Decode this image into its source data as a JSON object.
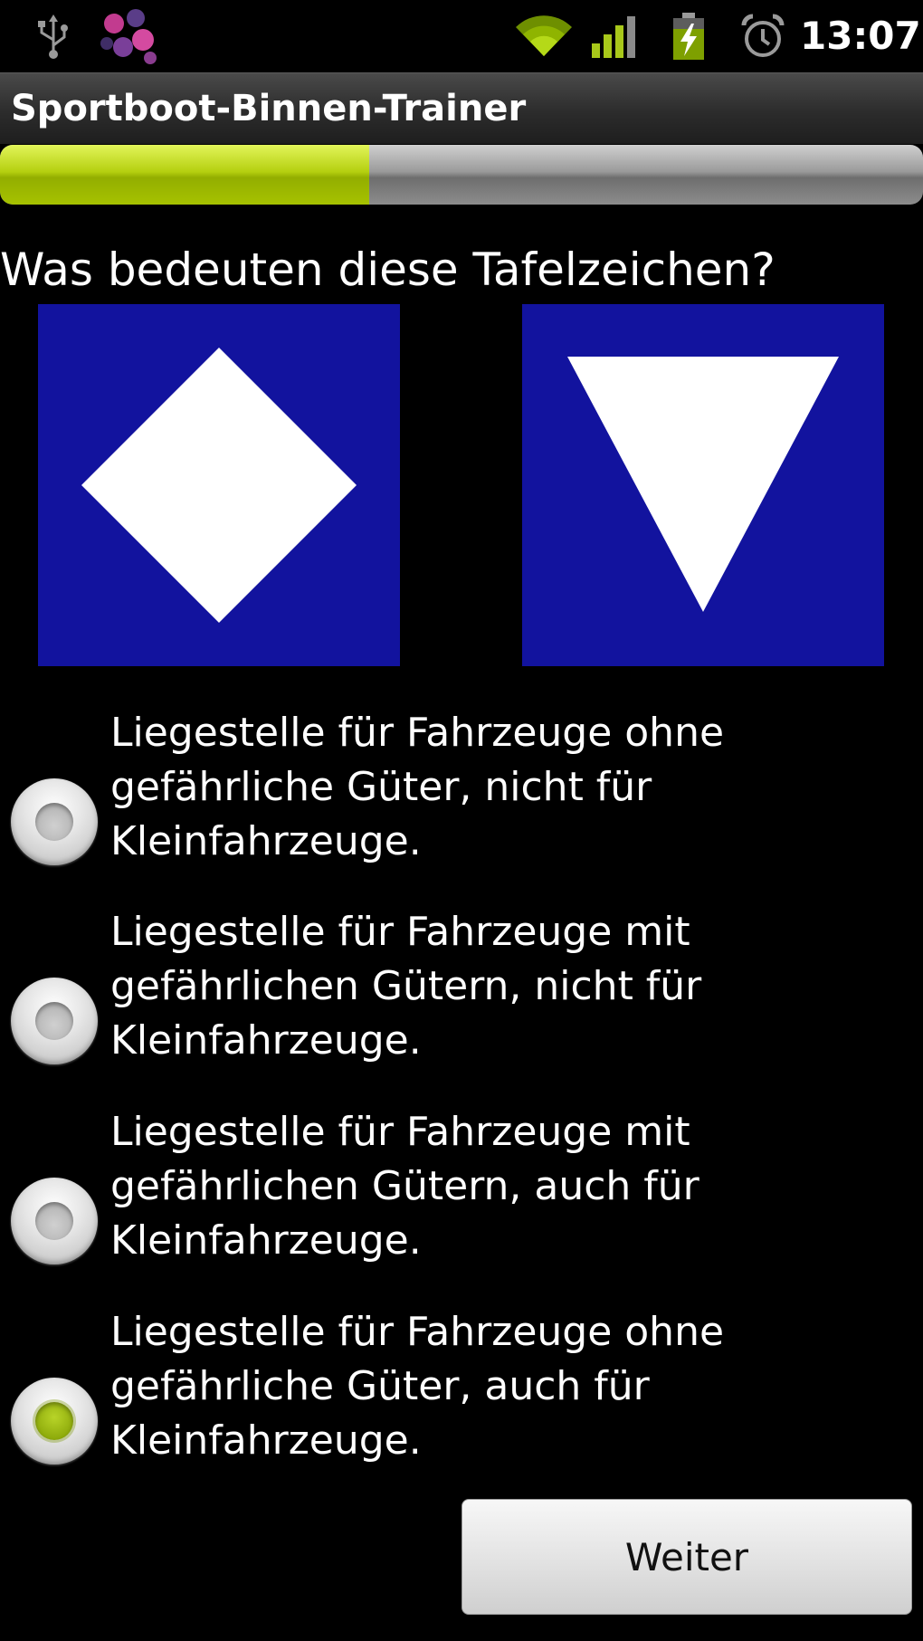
{
  "status_bar": {
    "time": "13:07",
    "icons": [
      "usb-icon",
      "app-notification-icon",
      "wifi-icon",
      "signal-icon",
      "battery-charging-icon",
      "alarm-icon"
    ]
  },
  "app": {
    "title": "Sportboot-Binnen-Trainer"
  },
  "progress": {
    "value": 0.4
  },
  "question": {
    "text": "Was bedeuten diese Tafelzeichen?",
    "signs": [
      {
        "shape": "white-diamond-on-blue",
        "background": "#12139e"
      },
      {
        "shape": "white-triangle-down-on-blue",
        "background": "#12139e"
      }
    ]
  },
  "answers": [
    {
      "label": "Liegestelle für Fahrzeuge ohne\ngefährliche Güter, nicht für\nKleinfahrzeuge.",
      "selected": false
    },
    {
      "label": "Liegestelle für Fahrzeuge mit\ngefährlichen Gütern, nicht für\nKleinfahrzeuge.",
      "selected": false
    },
    {
      "label": "Liegestelle für Fahrzeuge mit\ngefährlichen Gütern, auch für\nKleinfahrzeuge.",
      "selected": false
    },
    {
      "label": "Liegestelle für Fahrzeuge ohne\ngefährliche Güter, auch für\nKleinfahrzeuge.",
      "selected": true
    }
  ],
  "next_button": {
    "label": "Weiter"
  },
  "colors": {
    "accent": "#a6c200",
    "sign_blue": "#12139e"
  }
}
